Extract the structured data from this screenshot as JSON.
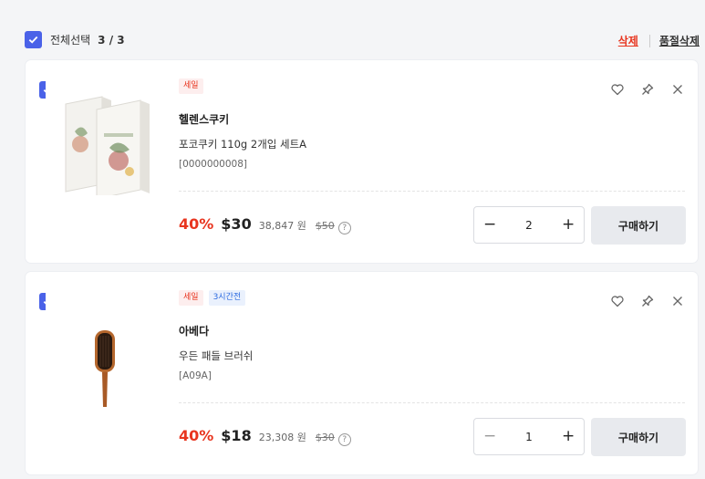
{
  "header": {
    "select_all_label": "전체선택",
    "select_all_count": "3 / 3",
    "delete_label": "삭제",
    "soldout_delete_label": "품절삭제"
  },
  "colors": {
    "accent": "#4a62e8",
    "sale": "#e8351f",
    "tag_blue": "#2c6be0"
  },
  "items": [
    {
      "checked": true,
      "tags": [
        "세일"
      ],
      "brand": "헬렌스쿠키",
      "name": "포코쿠키 110g 2개입 세트A",
      "code": "[0000000008]",
      "discount": "40%",
      "price": "$30",
      "price_krw": "38,847 원",
      "original_price": "$50",
      "info_icon": "?",
      "quantity": "2",
      "minus": "−",
      "plus": "+",
      "buy_label": "구매하기"
    },
    {
      "checked": true,
      "tags": [
        "세일",
        "3시간전"
      ],
      "brand": "아베다",
      "name": "우든 패들 브러쉬",
      "code": "[A09A]",
      "discount": "40%",
      "price": "$18",
      "price_krw": "23,308 원",
      "original_price": "$30",
      "info_icon": "?",
      "quantity": "1",
      "minus": "−",
      "plus": "+",
      "buy_label": "구매하기"
    }
  ],
  "icons": [
    "heart-icon",
    "pin-icon",
    "close-icon",
    "checkbox-check-icon",
    "info-icon"
  ]
}
